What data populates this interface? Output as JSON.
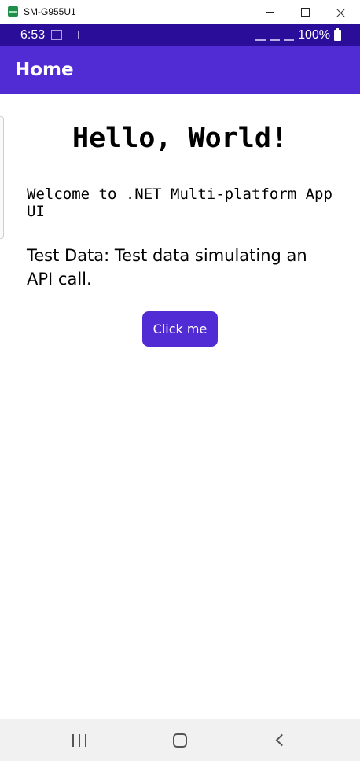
{
  "window": {
    "title": "SM-G955U1",
    "controls": [
      "minimize",
      "maximize",
      "close"
    ]
  },
  "status_bar": {
    "time": "6:53",
    "battery": "100%",
    "icons": [
      "notification-icon",
      "notification-icon",
      "mute-icon",
      "wifi-icon",
      "signal-icon",
      "battery-icon"
    ]
  },
  "header": {
    "title": "Home",
    "color": "#512bd4"
  },
  "main": {
    "heading": "Hello, World!",
    "welcome": "Welcome to .NET Multi-platform App UI",
    "test_data": "Test Data: Test data simulating an API call.",
    "button_label": "Click me"
  },
  "nav_bar": {
    "icons": [
      "recent-apps-icon",
      "home-icon",
      "back-icon"
    ]
  },
  "colors": {
    "accent": "#512bd4",
    "status_bar": "#2a0e9a"
  }
}
